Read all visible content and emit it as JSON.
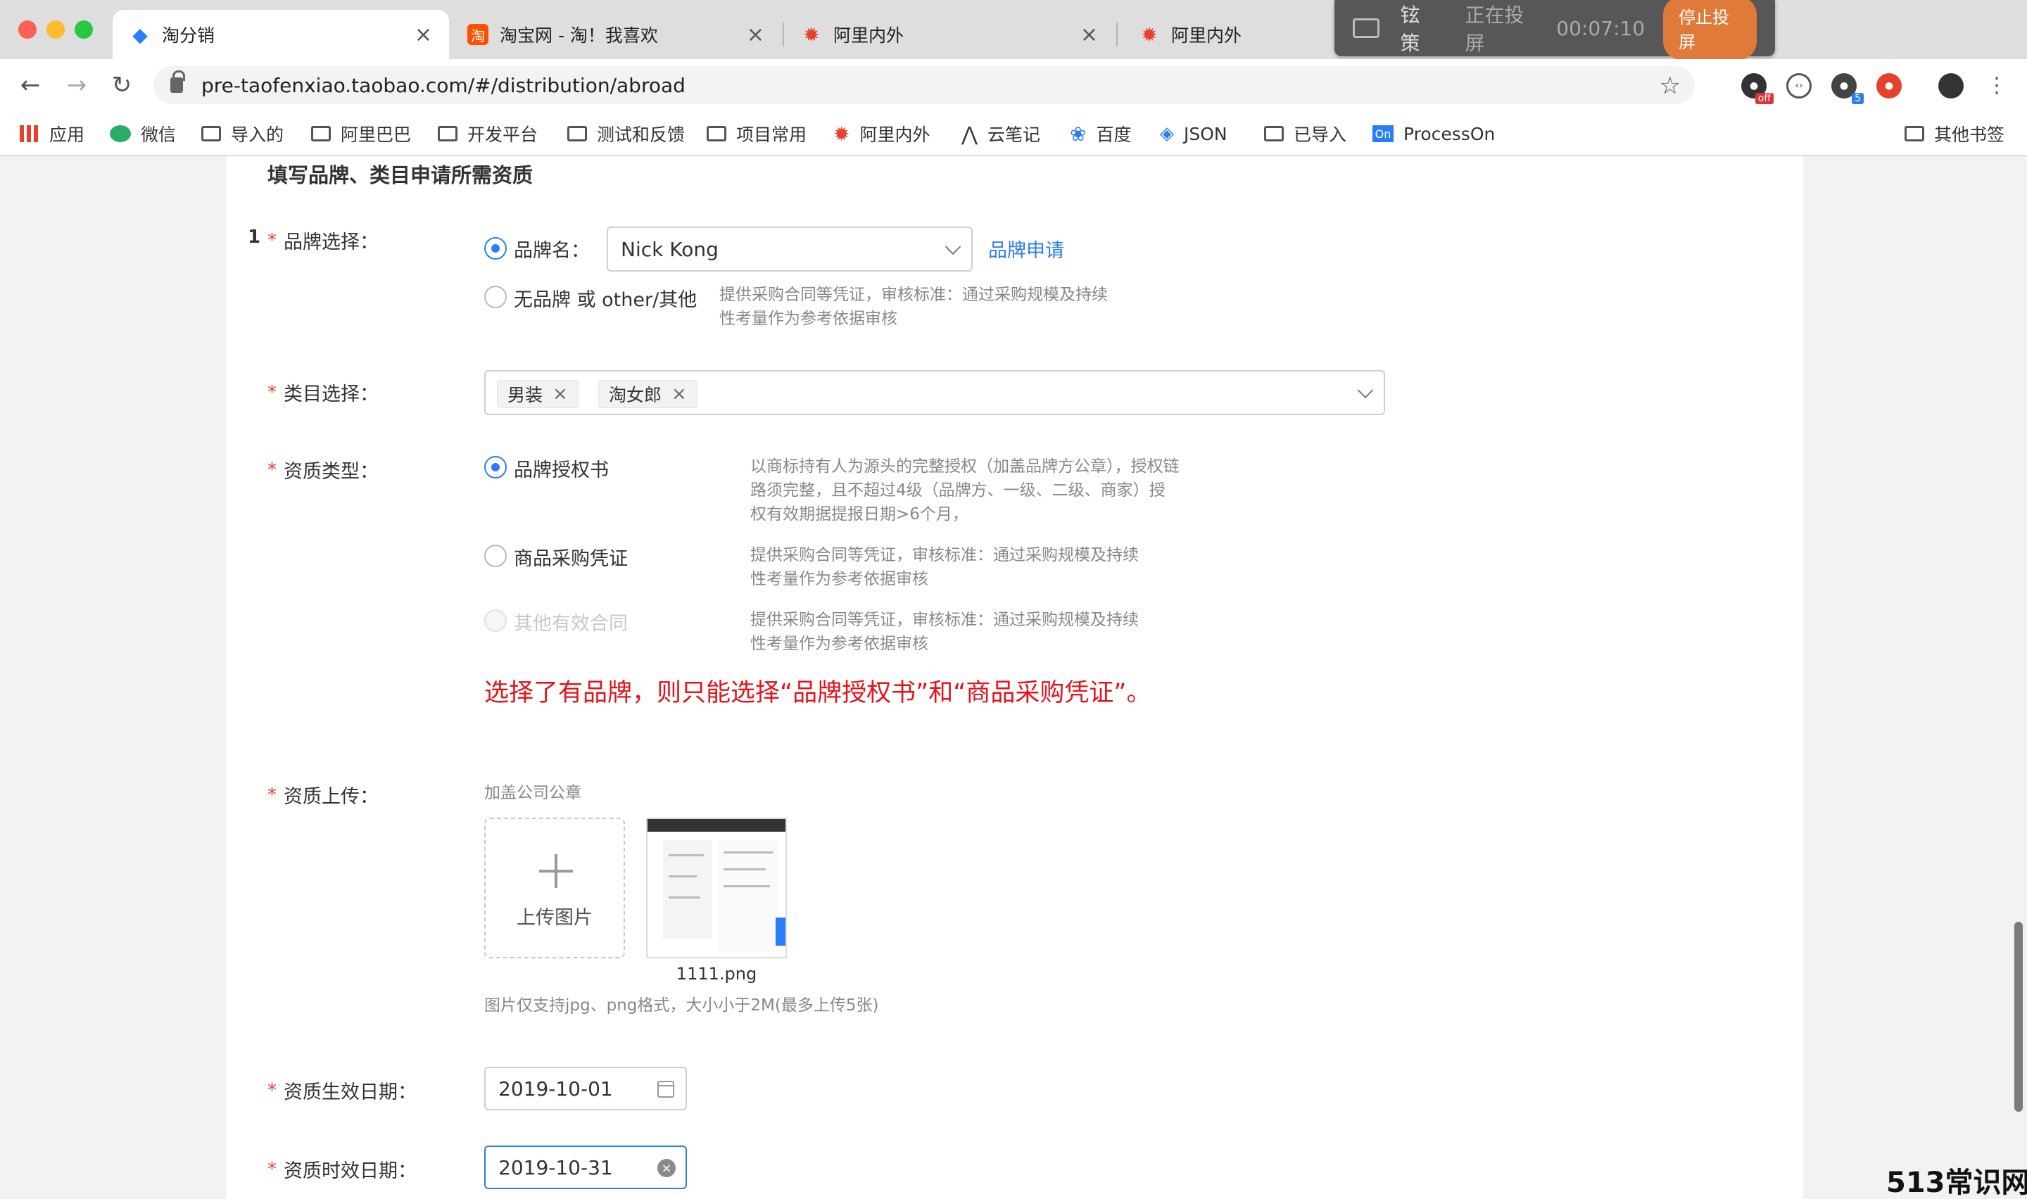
{
  "browser": {
    "tabs": [
      {
        "title": "淘分销",
        "active": true
      },
      {
        "title": "淘宝网 - 淘！我喜欢",
        "active": false
      },
      {
        "title": "阿里内外",
        "active": false
      },
      {
        "title": "阿里内外",
        "active": false
      }
    ],
    "cast": {
      "user": "铉策",
      "status": "正在投屏",
      "time": "00:07:10",
      "stop_label": "停止投屏"
    },
    "url": "pre-taofenxiao.taobao.com/#/distribution/abroad",
    "extension_badges": {
      "off": "off",
      "count": "5"
    },
    "bookmarks": [
      "应用",
      "微信",
      "导入的",
      "阿里巴巴",
      "开发平台",
      "测试和反馈",
      "项目常用",
      "阿里内外",
      "云笔记",
      "百度",
      "JSON",
      "已导入",
      "ProcessOn"
    ],
    "other_bookmarks": "其他书签"
  },
  "form": {
    "section_title": "填写品牌、类目申请所需资质",
    "row_index": "1",
    "brand": {
      "label": "品牌选择：",
      "option_named": "品牌名：",
      "selected_brand": "Nick Kong",
      "apply_link": "品牌申请",
      "option_none": "无品牌 或 other/其他",
      "option_none_hint": "提供采购合同等凭证，审核标准：通过采购规模及持续性考量作为参考依据审核"
    },
    "category": {
      "label": "类目选择：",
      "tags": [
        "男装",
        "淘女郎"
      ]
    },
    "qualification_type": {
      "label": "资质类型：",
      "options": [
        {
          "label": "品牌授权书",
          "hint": "以商标持有人为源头的完整授权（加盖品牌方公章），授权链路须完整，且不超过4级（品牌方、一级、二级、商家）授权有效期据提报日期>6个月，",
          "checked": true,
          "disabled": false
        },
        {
          "label": "商品采购凭证",
          "hint": "提供采购合同等凭证，审核标准：通过采购规模及持续性考量作为参考依据审核",
          "checked": false,
          "disabled": false
        },
        {
          "label": "其他有效合同",
          "hint": "提供采购合同等凭证，审核标准：通过采购规模及持续性考量作为参考依据审核",
          "checked": false,
          "disabled": true
        }
      ]
    },
    "warning": "选择了有品牌，则只能选择“品牌授权书”和“商品采购凭证”。",
    "upload": {
      "label": "资质上传：",
      "sublabel": "加盖公司公章",
      "button_text": "上传图片",
      "file_name": "1111.png",
      "help": "图片仅支持jpg、png格式，大小小于2M(最多上传5张)"
    },
    "start_date": {
      "label": "资质生效日期：",
      "value": "2019-10-01"
    },
    "end_date": {
      "label": "资质时效日期：",
      "value": "2019-10-31"
    }
  },
  "watermark": "513常识网",
  "colors": {
    "primary": "#2b7df7",
    "required": "#e5412c",
    "warning": "#e4141b"
  }
}
